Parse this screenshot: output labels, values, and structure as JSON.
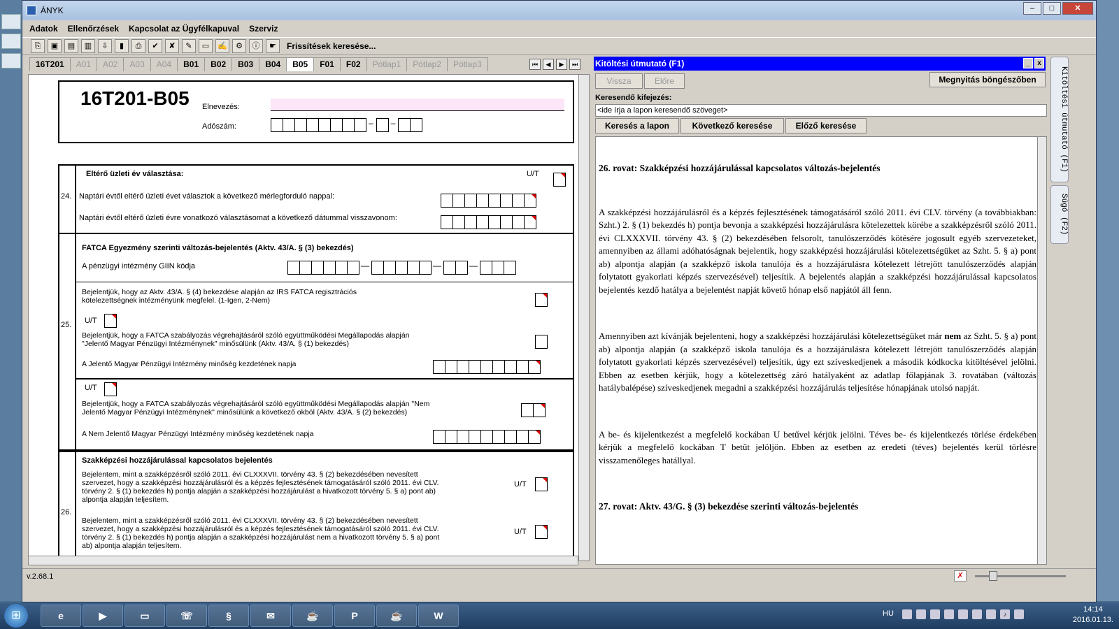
{
  "window": {
    "title": "ÁNYK"
  },
  "menu": [
    "Adatok",
    "Ellenőrzések",
    "Kapcsolat az Ügyfélkapuval",
    "Szerviz"
  ],
  "toolbar": {
    "update_label": "Frissítések keresése..."
  },
  "tabs": [
    {
      "label": "16T201",
      "state": "normal"
    },
    {
      "label": "A01",
      "state": "disabled"
    },
    {
      "label": "A02",
      "state": "disabled"
    },
    {
      "label": "A03",
      "state": "disabled"
    },
    {
      "label": "A04",
      "state": "disabled"
    },
    {
      "label": "B01",
      "state": "normal"
    },
    {
      "label": "B02",
      "state": "normal"
    },
    {
      "label": "B03",
      "state": "normal"
    },
    {
      "label": "B04",
      "state": "normal"
    },
    {
      "label": "B05",
      "state": "active"
    },
    {
      "label": "F01",
      "state": "normal"
    },
    {
      "label": "F02",
      "state": "normal"
    },
    {
      "label": "Pótlap1",
      "state": "disabled"
    },
    {
      "label": "Pótlap2",
      "state": "disabled"
    },
    {
      "label": "Pótlap3",
      "state": "disabled"
    }
  ],
  "form": {
    "code": "16T201-B05",
    "name_label": "Elnevezés:",
    "tax_label": "Adószám:",
    "s24_title": "Eltérő üzleti év választása:",
    "s24_ut": "U/T",
    "s24_num": "24.",
    "s24_row1": "Naptári évtől eltérő üzleti évet választok a következő mérlegforduló nappal:",
    "s24_row2": "Naptári évtől eltérő üzleti évre vonatkozó választásomat a következő dátummal visszavonom:",
    "s25_title": "FATCA Egyezmény szerinti változás-bejelentés (Aktv. 43/A. § (3) bekezdés)",
    "s25_giin": "A pénzügyi intézmény GIIN kódja",
    "s25_num": "25.",
    "s25_ut": "U/T",
    "s25_irs": "Bejelentjük, hogy az Aktv. 43/A. § (4) bekezdése alapján az IRS FATCA regisztrációs kötelezettségnek intézményünk megfelel. (1-Igen, 2-Nem)",
    "s25_jelento": "Bejelentjük, hogy a FATCA szabályozás végrehajtásáról szóló együttműködési Megállapodás alapján \"Jelentő Magyar Pénzügyi Intézménynek\" minősülünk (Aktv. 43/A. § (1) bekezdés)",
    "s25_jelento_date": "A Jelentő Magyar Pénzügyi Intézmény minőség kezdetének napja",
    "s25_ut2": "U/T",
    "s25_nem": "Bejelentjük, hogy a FATCA szabályozás végrehajtásáról szóló együttműködési Megállapodás alapján \"Nem Jelentő Magyar Pénzügyi Intézménynek\" minősülünk a következő okból (Aktv. 43/A. § (2) bekezdés)",
    "s25_nem_date": "A Nem Jelentő Magyar Pénzügyi Intézmény minőség kezdetének napja",
    "s26_title": "Szakképzési hozzájárulással kapcsolatos bejelentés",
    "s26_num": "26.",
    "s26_a": "Bejelentem, mint a szakképzésről szóló 2011. évi CLXXXVII. törvény 43. § (2) bekezdésében nevesített szervezet, hogy a szakképzési hozzájárulásról és a képzés fejlesztésének támogatásáról szóló 2011. évi CLV. törvény 2. § (1) bekezdés h) pontja alapján a szakképzési hozzájárulást a hivatkozott törvény 5. § a) pont ab) alpontja alapján teljesítem.",
    "s26_b": "Bejelentem, mint a szakképzésről szóló 2011. évi CLXXXVII. törvény 43. § (2) bekezdésében nevesített szervezet, hogy a szakképzési hozzájárulásról és a képzés fejlesztésének támogatásáról szóló 2011. évi CLV. törvény 2. § (1) bekezdés h) pontja alapján a szakképzési hozzájárulást nem a hivatkozott törvény 5. § a) pont ab) alpontja alapján teljesítem.",
    "s26_ut": "U/T"
  },
  "help": {
    "title": "Kitöltési útmutató (F1)",
    "back": "Vissza",
    "forward": "Előre",
    "open_browser": "Megnyitás böngészőben",
    "search_label": "Keresendő kifejezés:",
    "search_placeholder": "<ide írja a lapon keresendő szöveget>",
    "search_page": "Keresés a lapon",
    "find_next": "Következő keresése",
    "find_prev": "Előző keresése",
    "h26": "26. rovat: Szakképzési hozzájárulással kapcsolatos változás-bejelentés",
    "p1": "A szakképzési hozzájárulásról és a képzés fejlesztésének támogatásáról szóló 2011. évi CLV. törvény (a továbbiakban: Szht.) 2. § (1) bekezdés h) pontja bevonja a szakképzési hozzájárulásra kötelezettek körébe a szakképzésről szóló 2011. évi CLXXXVII. törvény 43. § (2) bekezdésében felsorolt, tanulószerződés kötésére jogosult egyéb szervezeteket, amennyiben az állami adóhatóságnak bejelentik, hogy szakképzési hozzájárulási kötelezettségüket az Szht. 5. § a) pont ab) alpontja alapján (a szakképző iskola tanulója és a hozzájárulásra kötelezett létrejött tanulószerződés alapján folytatott gyakorlati képzés szervezésével) teljesítik. A bejelentés alapján a szakképzési hozzájárulással kapcsolatos bejelentés kezdő hatálya a bejelentést napját követő hónap első napjától áll fenn.",
    "p2_a": "Amennyiben azt kívánják bejelenteni, hogy a szakképzési hozzájárulási kötelezettségüket már ",
    "p2_bold": "nem",
    "p2_b": " az Szht. 5. § a) pont ab) alpontja alapján (a szakképző iskola tanulója és a hozzájárulásra kötelezett létrejött tanulószerződés alapján folytatott gyakorlati képzés szervezésével) teljesítik, úgy ezt szíveskedjenek a második kódkocka kitöltésével jelölni. Ebben az esetben kérjük, hogy a kötelezettség záró hatályaként az adatlap főlapjának 3. rovatában (változás hatálybalépése) szíveskedjenek megadni a szakképzési hozzájárulás teljesítése hónapjának utolsó napját.",
    "p3": "A be- és kijelentkezést a megfelelő kockában U betűvel kérjük jelölni. Téves be- és kijelentkezés törlése érdekében kérjük a megfelelő kockában T betűt jelöljön. Ebben az esetben az eredeti (téves) bejelentés kerül törlésre visszamenőleges hatállyal.",
    "h27": "27. rovat: Aktv. 43/G. § (3) bekezdése szerinti változás-bejelentés"
  },
  "side_tabs": [
    "Kitöltési útmutató (F1)",
    "Súgó (F2)"
  ],
  "status": {
    "version": "v.2.68.1"
  },
  "taskbar": {
    "lang": "HU",
    "time": "14:14",
    "date": "2016.01.13."
  }
}
